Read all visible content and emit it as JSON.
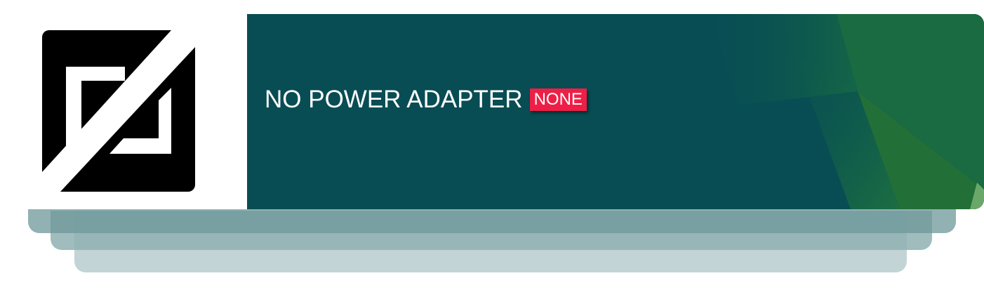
{
  "banner": {
    "headline": "NO POWER ADAPTER",
    "badge": "NONE"
  },
  "logo": {
    "icon": "no-power-adapter-icon"
  },
  "colors": {
    "banner_background": "#084d54",
    "badge_background": "#ee1f46",
    "accent_green": "#1e7a3a",
    "logo_fill": "#000000"
  }
}
